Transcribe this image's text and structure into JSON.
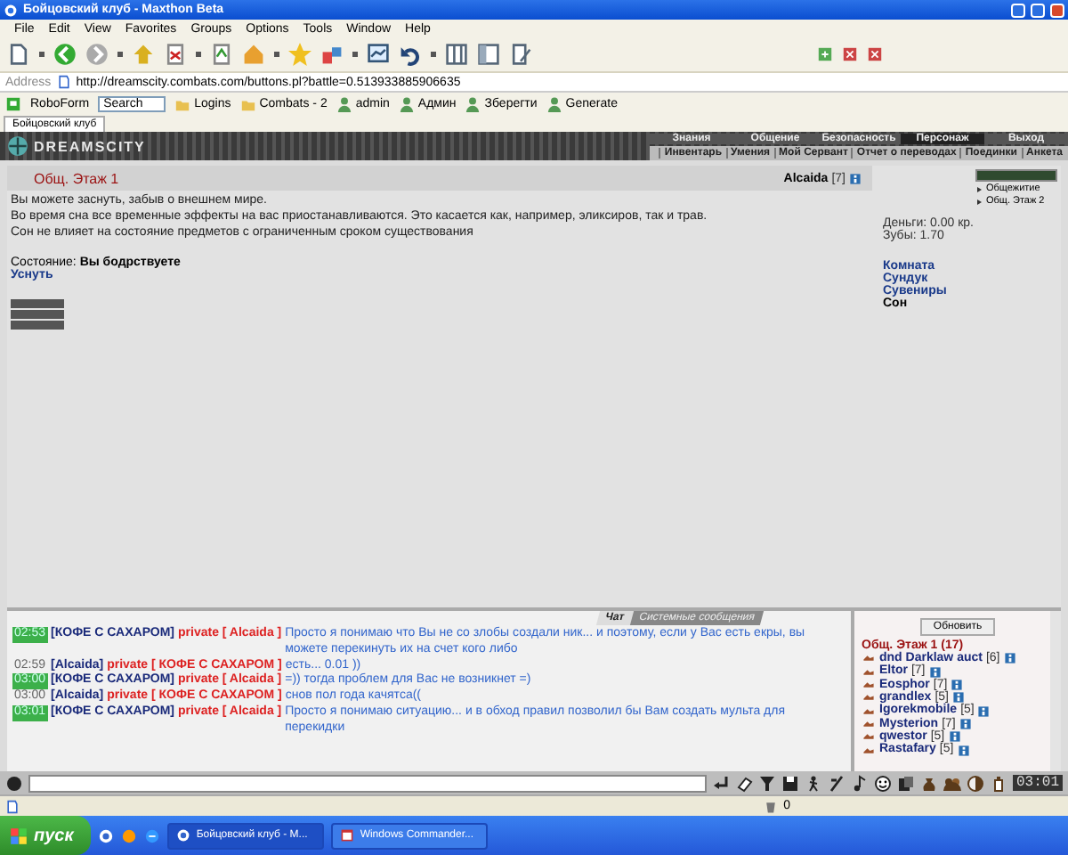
{
  "window": {
    "title": "Бойцовский клуб - Maxthon Beta"
  },
  "menu": [
    "File",
    "Edit",
    "View",
    "Favorites",
    "Groups",
    "Options",
    "Tools",
    "Window",
    "Help"
  ],
  "address": {
    "label": "Address",
    "value": "http://dreamscity.combats.com/buttons.pl?battle=0.513933885906635"
  },
  "links_bar": {
    "roboform": "RoboForm",
    "search": {
      "value": "Search"
    },
    "links": [
      "Logins",
      "Combats - 2",
      "admin",
      "Админ",
      "Зберегти",
      "Generate"
    ]
  },
  "tabs": [
    {
      "label": "Бойцовский клуб",
      "selected": true
    }
  ],
  "game": {
    "logo": "DREAMSCITY",
    "nav_top": [
      {
        "label": "Знания",
        "selected": false
      },
      {
        "label": "Общение",
        "selected": false
      },
      {
        "label": "Безопасность",
        "selected": false
      },
      {
        "label": "Персонаж",
        "selected": true
      },
      {
        "label": "Выход",
        "selected": false
      }
    ],
    "nav_sub": [
      "Инвентарь",
      "Умения",
      "Мой Сервант",
      "Отчет о переводах",
      "Поединки",
      "Анкета"
    ]
  },
  "room": {
    "title": "Общ. Этаж 1",
    "player": "Alcaida",
    "player_level": "[7]",
    "description": [
      "Вы можете заснуть, забыв о внешнем мире.",
      "Во время сна все временные эффекты на вас приостанавливаются. Это касается как, например, эликсиров, так и трав.",
      "Сон не влияет на состояние предметов с ограниченным сроком существования"
    ],
    "state_label": "Состояние:",
    "state_value": "Вы бодрствуете",
    "action": "Уснуть",
    "locations": [
      "Общежитие",
      "Общ. Этаж 2"
    ],
    "money": "Деньги: 0.00 кр.",
    "teeth_label": "Зубы:",
    "teeth_value": "1.70",
    "links": [
      {
        "label": "Комната",
        "selected": false
      },
      {
        "label": "Сундук",
        "selected": false
      },
      {
        "label": "Сувениры",
        "selected": false
      },
      {
        "label": "Сон",
        "selected": true
      }
    ]
  },
  "chat": {
    "tabs": [
      {
        "label": "Чат",
        "selected": true
      },
      {
        "label": "Системные сообщения",
        "selected": false
      }
    ],
    "messages": [
      {
        "time": "02:53",
        "highlighted": true,
        "sender": "[КОФЕ С САХАРОМ]",
        "recipient": "private [ Alcaida ]",
        "text": "Просто я понимаю что Вы не со злобы создали ник... и поэтому, если у Вас есть екры, вы можете перекинуть их на счет кого либо"
      },
      {
        "time": "02:59",
        "highlighted": false,
        "sender": "[Alcaida]",
        "recipient": "private [ КОФЕ С САХАРОМ ]",
        "text": "есть... 0.01 ))"
      },
      {
        "time": "03:00",
        "highlighted": true,
        "sender": "[КОФЕ С САХАРОМ]",
        "recipient": "private [ Alcaida ]",
        "text": "=)) тогда проблем для Вас не возникнет =)"
      },
      {
        "time": "03:00",
        "highlighted": false,
        "sender": "[Alcaida]",
        "recipient": "private [ КОФЕ С САХАРОМ ]",
        "text": "снов пол года качятса(("
      },
      {
        "time": "03:01",
        "highlighted": true,
        "sender": "[КОФЕ С САХАРОМ]",
        "recipient": "private [ Alcaida ]",
        "text": "Просто я понимаю ситуацию... и в обход правил позволил бы Вам создать мульта для перекидки"
      }
    ]
  },
  "players": {
    "button": "Обновить",
    "title": "Общ. Этаж 1 (17)",
    "list": [
      {
        "name": "dnd Darklaw auct",
        "level": "[6]"
      },
      {
        "name": "Eltor",
        "level": "[7]"
      },
      {
        "name": "Eosphor",
        "level": "[7]"
      },
      {
        "name": "grandlex",
        "level": "[5]"
      },
      {
        "name": "Igorekmobile",
        "level": "[5]"
      },
      {
        "name": "Mysterion",
        "level": "[7]"
      },
      {
        "name": "qwestor",
        "level": "[5]"
      },
      {
        "name": "Rastafary",
        "level": "[5]"
      }
    ]
  },
  "clock": "03:01",
  "status_bar": {
    "count": "0"
  },
  "taskbar": {
    "start": "пуск",
    "tasks": [
      {
        "label": "Бойцовский клуб - M...",
        "selected": true
      },
      {
        "label": "Windows Commander...",
        "selected": false
      }
    ]
  }
}
